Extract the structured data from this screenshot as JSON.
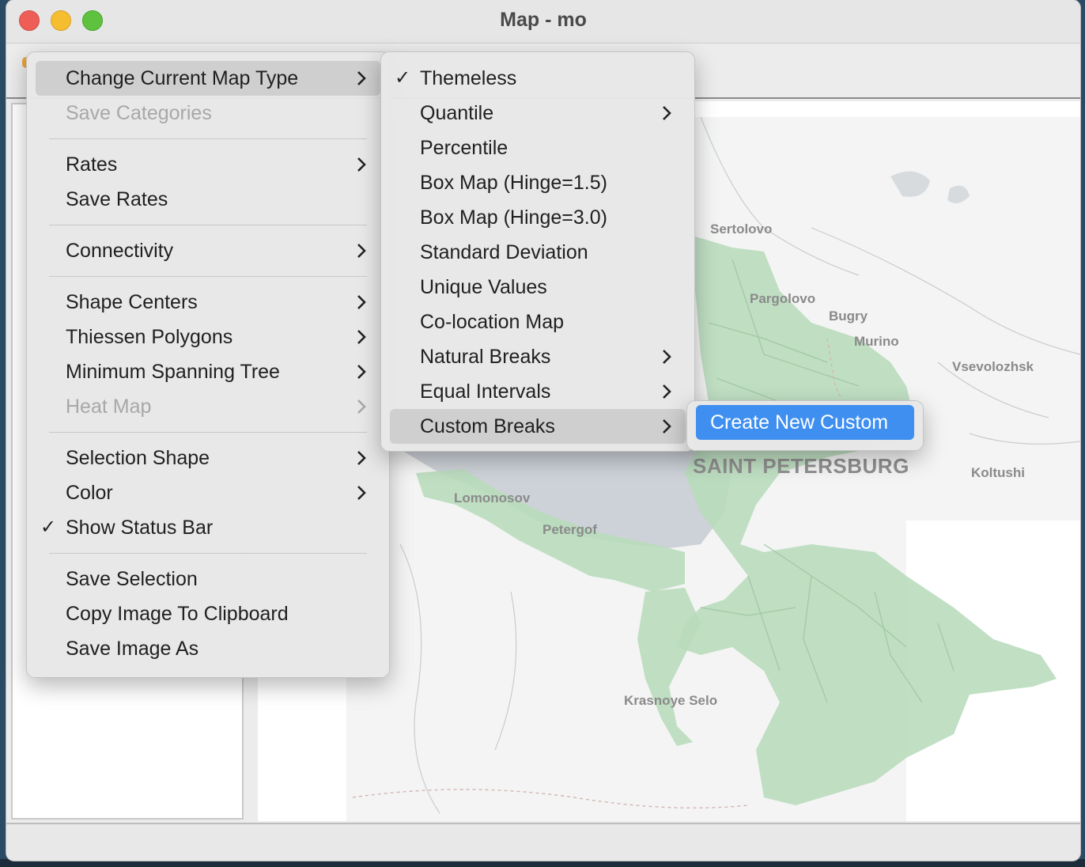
{
  "window": {
    "title": "Map - mo"
  },
  "map": {
    "places": {
      "sertolovo": "Sertolovo",
      "pargolovo": "Pargolovo",
      "bugry": "Bugry",
      "murino": "Murino",
      "vsevolozhsk": "Vsevolozhsk",
      "saint_petersburg": "SAINT PETERSBURG",
      "koltushi": "Koltushi",
      "lomonosov": "Lomonosov",
      "petergof": "Petergof",
      "krasnoye_selo": "Krasnoye Selo"
    },
    "colors": {
      "region_fill": "#b9dcbc",
      "water": "#cdd2d8",
      "background": "#f4f4f4"
    }
  },
  "context_menu": {
    "items": [
      {
        "label": "Change Current Map Type",
        "submenu": true,
        "highlighted": true
      },
      {
        "label": "Save Categories",
        "disabled": true
      },
      {
        "label": "Rates",
        "submenu": true
      },
      {
        "label": "Save Rates"
      },
      {
        "label": "Connectivity",
        "submenu": true
      },
      {
        "label": "Shape Centers",
        "submenu": true
      },
      {
        "label": "Thiessen Polygons",
        "submenu": true
      },
      {
        "label": "Minimum Spanning Tree",
        "submenu": true
      },
      {
        "label": "Heat Map",
        "submenu": true,
        "disabled": true
      },
      {
        "label": "Selection Shape",
        "submenu": true
      },
      {
        "label": "Color",
        "submenu": true
      },
      {
        "label": "Show Status Bar",
        "checked": true
      },
      {
        "label": "Save Selection"
      },
      {
        "label": "Copy Image To Clipboard"
      },
      {
        "label": "Save Image As"
      }
    ]
  },
  "map_type_submenu": {
    "items": [
      {
        "label": "Themeless",
        "checked": true
      },
      {
        "label": "Quantile",
        "submenu": true
      },
      {
        "label": "Percentile"
      },
      {
        "label": "Box Map (Hinge=1.5)"
      },
      {
        "label": "Box Map (Hinge=3.0)"
      },
      {
        "label": "Standard Deviation"
      },
      {
        "label": "Unique Values"
      },
      {
        "label": "Co-location Map"
      },
      {
        "label": "Natural Breaks",
        "submenu": true
      },
      {
        "label": "Equal Intervals",
        "submenu": true
      },
      {
        "label": "Custom Breaks",
        "submenu": true,
        "highlighted": true
      }
    ]
  },
  "custom_breaks_submenu": {
    "items": [
      {
        "label": "Create New Custom",
        "selected": true
      }
    ]
  },
  "icons": {
    "check": "check-icon",
    "submenu": "chevron-right-icon"
  },
  "accent_color": "#3f8ff0"
}
